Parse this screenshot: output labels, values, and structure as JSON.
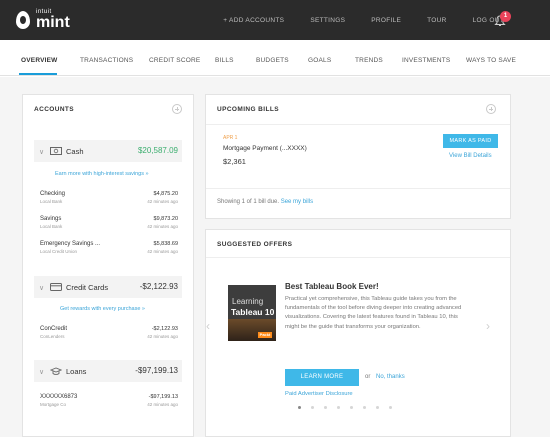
{
  "brand": {
    "intuit": "intuit",
    "name": "mint"
  },
  "topnav": [
    "+ ADD ACCOUNTS",
    "SETTINGS",
    "PROFILE",
    "TOUR",
    "LOG OUT"
  ],
  "notifications": {
    "count": "1"
  },
  "subnav": [
    "OVERVIEW",
    "TRANSACTIONS",
    "CREDIT SCORE",
    "BILLS",
    "BUDGETS",
    "GOALS",
    "TRENDS",
    "INVESTMENTS",
    "WAYS TO SAVE"
  ],
  "accounts": {
    "title": "ACCOUNTS",
    "cash": {
      "label": "Cash",
      "amount": "$20,587.09",
      "promo": "Earn more with high-interest savings »",
      "rows": [
        {
          "name": "Checking",
          "sub": "Local Bank",
          "amount": "$4,875.20",
          "time": "42 minutes ago"
        },
        {
          "name": "Savings",
          "sub": "Local Bank",
          "amount": "$9,873.20",
          "time": "42 minutes ago"
        },
        {
          "name": "Emergency Savings ...",
          "sub": "Local Credit Union",
          "amount": "$5,838.69",
          "time": "42 minutes ago"
        }
      ]
    },
    "credit": {
      "label": "Credit Cards",
      "amount": "-$2,122.93",
      "promo": "Get rewards with every purchase »",
      "rows": [
        {
          "name": "ConCredit",
          "sub": "ConLenders",
          "amount": "-$2,122.93",
          "time": "42 minutes ago"
        }
      ]
    },
    "loans": {
      "label": "Loans",
      "amount": "-$97,199.13",
      "rows": [
        {
          "name": "XXXXXX6873",
          "sub": "Mortgage Co",
          "amount": "-$97,199.13",
          "time": "42 minutes ago"
        }
      ]
    }
  },
  "bills": {
    "title": "UPCOMING BILLS",
    "date": "APR 1",
    "name": "Mortgage Payment (...XXXX)",
    "amount": "$2,361",
    "mark_paid": "MARK AS PAID",
    "view_details": "View Bill Details",
    "showing": "Showing 1 of 1 bill due.",
    "see_bills": "See my bills"
  },
  "offers": {
    "title": "SUGGESTED OFFERS",
    "headline": "Best Tableau Book Ever!",
    "body": "Practical yet comprehensive, this Tableau guide takes you from the fundamentals of the tool before diving deeper into creating advanced visualizations. Covering the latest features found in Tableau 10, this might be the guide that transforms your organization.",
    "learn_more": "LEARN MORE",
    "or": "or",
    "no_thanks": "No, thanks",
    "disclosure": "Paid Advertiser Disclosure",
    "book": {
      "line1": "Learning",
      "line2": "Tableau 10",
      "badge": "Packt"
    }
  },
  "colors": {
    "topbar": "#2b2b2b",
    "accent": "#1a9dd9",
    "positive": "#3cae6f",
    "button": "#3fb8e8",
    "badge": "#e9435a"
  }
}
